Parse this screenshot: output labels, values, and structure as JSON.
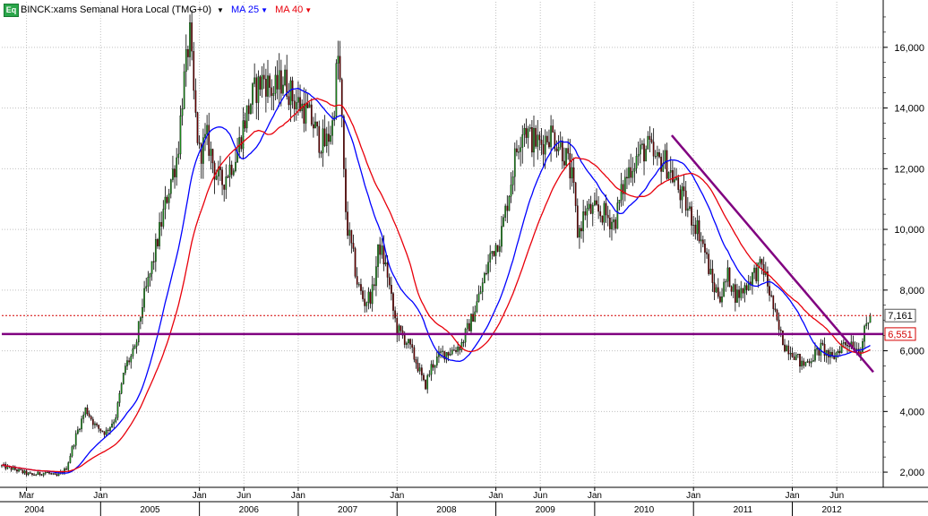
{
  "header": {
    "icon_label": "Eq",
    "symbol": "BINCK:xams Semanal Hora Local (TMG+0)",
    "ma25_label": "MA 25",
    "ma40_label": "MA 40"
  },
  "chart_data": {
    "type": "candlestick",
    "title": "BINCK:xams Semanal Hora Local (TMG+0)",
    "y_axis": {
      "range": [
        1500,
        17500
      ],
      "ticks": [
        2000,
        4000,
        6000,
        8000,
        10000,
        12000,
        14000,
        16000
      ],
      "tick_labels": [
        "2,000",
        "4,000",
        "6,000",
        "8,000",
        "10,000",
        "12,000",
        "14,000",
        "16,000"
      ]
    },
    "x_axis": {
      "range": [
        2004.0,
        2012.92
      ],
      "month_labels": [
        {
          "x": 2004.25,
          "label": "Mar"
        },
        {
          "x": 2005.0,
          "label": "Jan"
        },
        {
          "x": 2006.0,
          "label": "Jan"
        },
        {
          "x": 2006.45,
          "label": "Jun"
        },
        {
          "x": 2007.0,
          "label": "Jan"
        },
        {
          "x": 2008.0,
          "label": "Jan"
        },
        {
          "x": 2009.0,
          "label": "Jan"
        },
        {
          "x": 2009.45,
          "label": "Jun"
        },
        {
          "x": 2010.0,
          "label": "Jan"
        },
        {
          "x": 2011.0,
          "label": "Jan"
        },
        {
          "x": 2012.0,
          "label": "Jan"
        },
        {
          "x": 2012.45,
          "label": "Jun"
        }
      ],
      "year_labels": [
        {
          "x": 2004.33,
          "label": "2004"
        },
        {
          "x": 2005.5,
          "label": "2005"
        },
        {
          "x": 2006.5,
          "label": "2006"
        },
        {
          "x": 2007.5,
          "label": "2007"
        },
        {
          "x": 2008.5,
          "label": "2008"
        },
        {
          "x": 2009.5,
          "label": "2009"
        },
        {
          "x": 2010.5,
          "label": "2010"
        },
        {
          "x": 2011.5,
          "label": "2011"
        },
        {
          "x": 2012.4,
          "label": "2012"
        }
      ]
    },
    "grid": true,
    "price_waypoints": [
      [
        2004.0,
        2200
      ],
      [
        2004.12,
        2100
      ],
      [
        2004.3,
        1900
      ],
      [
        2004.45,
        2000
      ],
      [
        2004.55,
        1850
      ],
      [
        2004.65,
        2100
      ],
      [
        2004.75,
        3200
      ],
      [
        2004.85,
        4100
      ],
      [
        2004.95,
        3500
      ],
      [
        2005.05,
        3300
      ],
      [
        2005.15,
        3800
      ],
      [
        2005.25,
        5500
      ],
      [
        2005.35,
        6000
      ],
      [
        2005.42,
        7500
      ],
      [
        2005.5,
        8500
      ],
      [
        2005.6,
        10000
      ],
      [
        2005.7,
        11500
      ],
      [
        2005.78,
        12500
      ],
      [
        2005.83,
        14500
      ],
      [
        2005.87,
        15500
      ],
      [
        2005.9,
        16500
      ],
      [
        2005.95,
        14000
      ],
      [
        2006.0,
        12500
      ],
      [
        2006.08,
        13000
      ],
      [
        2006.15,
        12000
      ],
      [
        2006.22,
        11500
      ],
      [
        2006.3,
        12000
      ],
      [
        2006.38,
        12500
      ],
      [
        2006.45,
        13500
      ],
      [
        2006.55,
        14500
      ],
      [
        2006.65,
        15000
      ],
      [
        2006.75,
        14500
      ],
      [
        2006.85,
        15000
      ],
      [
        2006.95,
        14300
      ],
      [
        2007.05,
        14000
      ],
      [
        2007.15,
        13500
      ],
      [
        2007.2,
        13000
      ],
      [
        2007.28,
        12800
      ],
      [
        2007.35,
        13500
      ],
      [
        2007.4,
        15800
      ],
      [
        2007.43,
        14500
      ],
      [
        2007.47,
        11000
      ],
      [
        2007.5,
        10000
      ],
      [
        2007.55,
        9200
      ],
      [
        2007.6,
        8200
      ],
      [
        2007.67,
        7600
      ],
      [
        2007.75,
        7900
      ],
      [
        2007.82,
        9500
      ],
      [
        2007.9,
        8600
      ],
      [
        2007.95,
        7500
      ],
      [
        2008.0,
        6700
      ],
      [
        2008.1,
        6300
      ],
      [
        2008.2,
        5600
      ],
      [
        2008.28,
        4800
      ],
      [
        2008.35,
        5500
      ],
      [
        2008.45,
        5900
      ],
      [
        2008.55,
        6000
      ],
      [
        2008.65,
        6200
      ],
      [
        2008.75,
        7000
      ],
      [
        2008.85,
        8000
      ],
      [
        2008.95,
        9200
      ],
      [
        2009.05,
        9800
      ],
      [
        2009.12,
        11000
      ],
      [
        2009.2,
        12500
      ],
      [
        2009.28,
        13500
      ],
      [
        2009.35,
        13000
      ],
      [
        2009.45,
        12800
      ],
      [
        2009.55,
        13200
      ],
      [
        2009.65,
        12800
      ],
      [
        2009.72,
        12300
      ],
      [
        2009.78,
        11500
      ],
      [
        2009.83,
        9800
      ],
      [
        2009.9,
        10600
      ],
      [
        2010.0,
        10600
      ],
      [
        2010.1,
        10500
      ],
      [
        2010.2,
        10200
      ],
      [
        2010.28,
        11300
      ],
      [
        2010.35,
        12000
      ],
      [
        2010.45,
        12500
      ],
      [
        2010.55,
        12700
      ],
      [
        2010.62,
        12200
      ],
      [
        2010.7,
        12300
      ],
      [
        2010.78,
        11800
      ],
      [
        2010.85,
        11300
      ],
      [
        2010.95,
        10600
      ],
      [
        2011.05,
        10000
      ],
      [
        2011.12,
        9200
      ],
      [
        2011.2,
        8100
      ],
      [
        2011.28,
        7800
      ],
      [
        2011.35,
        8500
      ],
      [
        2011.43,
        7800
      ],
      [
        2011.5,
        8000
      ],
      [
        2011.6,
        8500
      ],
      [
        2011.7,
        8800
      ],
      [
        2011.78,
        7800
      ],
      [
        2011.85,
        6800
      ],
      [
        2011.92,
        6200
      ],
      [
        2012.0,
        6000
      ],
      [
        2012.1,
        5500
      ],
      [
        2012.2,
        5800
      ],
      [
        2012.3,
        6100
      ],
      [
        2012.4,
        5700
      ],
      [
        2012.5,
        6200
      ],
      [
        2012.6,
        6300
      ],
      [
        2012.68,
        6000
      ],
      [
        2012.75,
        6800
      ],
      [
        2012.8,
        7161
      ]
    ],
    "series": [
      {
        "name": "MA 25",
        "color": "#0000ff",
        "period": 25
      },
      {
        "name": "MA 40",
        "color": "#e8000b",
        "period": 40
      }
    ],
    "candle_colors": {
      "up": "#1a8a1a",
      "down": "#6b0000",
      "wick": "#000000"
    },
    "annotations": {
      "horizontal_line": {
        "value": 6551,
        "color": "#800080"
      },
      "trend_line": {
        "x1": 2010.78,
        "y1": 13100,
        "x2": 2012.82,
        "y2": 5300,
        "color": "#800080"
      },
      "current_price_line": {
        "value": 7161,
        "color": "#d40000"
      }
    },
    "price_labels": [
      {
        "value": 7161,
        "label": "7,161",
        "text_color": "#000000",
        "border_color": "#555555"
      },
      {
        "value": 6551,
        "label": "6,551",
        "text_color": "#d40000",
        "border_color": "#d40000"
      }
    ]
  }
}
